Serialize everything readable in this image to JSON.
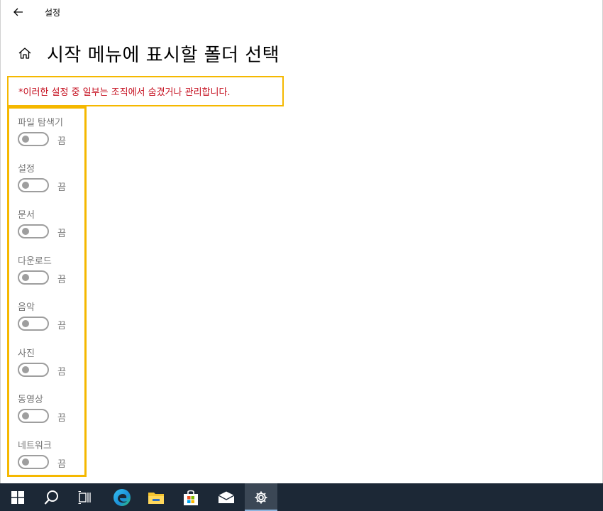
{
  "window": {
    "app_title": "설정"
  },
  "page": {
    "title": "시작 메뉴에 표시할 폴더 선택"
  },
  "notice": {
    "text": "*이러한 설정 중 일부는 조직에서 숨겼거나 관리합니다.",
    "color": "#c50f1f"
  },
  "folders": [
    {
      "label": "파일 탐색기",
      "state": "끔",
      "on": false
    },
    {
      "label": "설정",
      "state": "끔",
      "on": false
    },
    {
      "label": "문서",
      "state": "끔",
      "on": false
    },
    {
      "label": "다운로드",
      "state": "끔",
      "on": false
    },
    {
      "label": "음악",
      "state": "끔",
      "on": false
    },
    {
      "label": "사진",
      "state": "끔",
      "on": false
    },
    {
      "label": "동영상",
      "state": "끔",
      "on": false
    },
    {
      "label": "네트워크",
      "state": "끔",
      "on": false
    }
  ],
  "highlight_color": "#f5b800",
  "taskbar": {
    "items": [
      {
        "icon": "windows-start-icon"
      },
      {
        "icon": "search-icon"
      },
      {
        "icon": "task-view-icon"
      },
      {
        "icon": "edge-browser-icon"
      },
      {
        "icon": "file-explorer-icon"
      },
      {
        "icon": "microsoft-store-icon"
      },
      {
        "icon": "mail-icon"
      },
      {
        "icon": "settings-gear-icon",
        "active": true
      }
    ]
  }
}
